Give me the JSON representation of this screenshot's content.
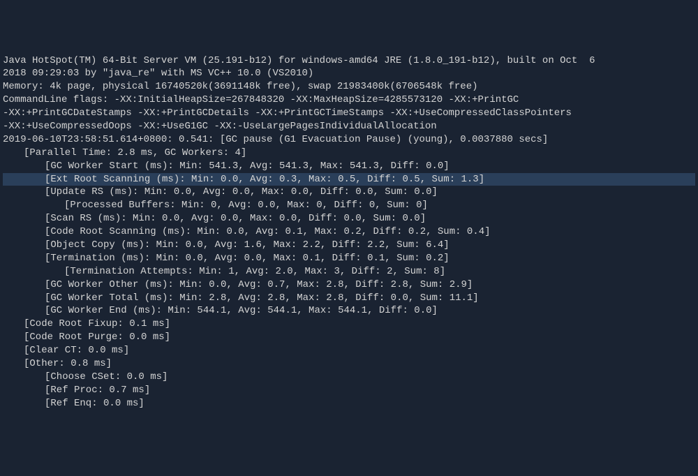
{
  "lines": [
    {
      "text": "Java HotSpot(TM) 64-Bit Server VM (25.191-b12) for windows-amd64 JRE (1.8.0_191-b12), built on Oct  6",
      "indent": 0
    },
    {
      "text": "2018 09:29:03 by \"java_re\" with MS VC++ 10.0 (VS2010)",
      "indent": 0
    },
    {
      "text": "Memory: 4k page, physical 16740520k(3691148k free), swap 21983400k(6706548k free)",
      "indent": 0
    },
    {
      "text": "CommandLine flags: -XX:InitialHeapSize=267848320 -XX:MaxHeapSize=4285573120 -XX:+PrintGC",
      "indent": 0
    },
    {
      "text": "-XX:+PrintGCDateStamps -XX:+PrintGCDetails -XX:+PrintGCTimeStamps -XX:+UseCompressedClassPointers",
      "indent": 0
    },
    {
      "text": "-XX:+UseCompressedOops -XX:+UseG1GC -XX:-UseLargePagesIndividualAllocation",
      "indent": 0
    },
    {
      "text": "2019-06-10T23:58:51.614+0800: 0.541: [GC pause (G1 Evacuation Pause) (young), 0.0037880 secs]",
      "indent": 0
    },
    {
      "text": "[Parallel Time: 2.8 ms, GC Workers: 4]",
      "indent": 1
    },
    {
      "text": "[GC Worker Start (ms): Min: 541.3, Avg: 541.3, Max: 541.3, Diff: 0.0]",
      "indent": 2
    },
    {
      "text": "[Ext Root Scanning (ms): Min: 0.0, Avg: 0.3, Max: 0.5, Diff: 0.5, Sum: 1.3]",
      "indent": 2,
      "highlighted": true
    },
    {
      "text": "[Update RS (ms): Min: 0.0, Avg: 0.0, Max: 0.0, Diff: 0.0, Sum: 0.0]",
      "indent": 2
    },
    {
      "text": "[Processed Buffers: Min: 0, Avg: 0.0, Max: 0, Diff: 0, Sum: 0]",
      "indent": 3
    },
    {
      "text": "[Scan RS (ms): Min: 0.0, Avg: 0.0, Max: 0.0, Diff: 0.0, Sum: 0.0]",
      "indent": 2
    },
    {
      "text": "[Code Root Scanning (ms): Min: 0.0, Avg: 0.1, Max: 0.2, Diff: 0.2, Sum: 0.4]",
      "indent": 2
    },
    {
      "text": "[Object Copy (ms): Min: 0.0, Avg: 1.6, Max: 2.2, Diff: 2.2, Sum: 6.4]",
      "indent": 2
    },
    {
      "text": "[Termination (ms): Min: 0.0, Avg: 0.0, Max: 0.1, Diff: 0.1, Sum: 0.2]",
      "indent": 2
    },
    {
      "text": "[Termination Attempts: Min: 1, Avg: 2.0, Max: 3, Diff: 2, Sum: 8]",
      "indent": 3
    },
    {
      "text": "[GC Worker Other (ms): Min: 0.0, Avg: 0.7, Max: 2.8, Diff: 2.8, Sum: 2.9]",
      "indent": 2
    },
    {
      "text": "[GC Worker Total (ms): Min: 2.8, Avg: 2.8, Max: 2.8, Diff: 0.0, Sum: 11.1]",
      "indent": 2
    },
    {
      "text": "[GC Worker End (ms): Min: 544.1, Avg: 544.1, Max: 544.1, Diff: 0.0]",
      "indent": 2
    },
    {
      "text": "[Code Root Fixup: 0.1 ms]",
      "indent": 1
    },
    {
      "text": "[Code Root Purge: 0.0 ms]",
      "indent": 1
    },
    {
      "text": "[Clear CT: 0.0 ms]",
      "indent": 1
    },
    {
      "text": "[Other: 0.8 ms]",
      "indent": 1
    },
    {
      "text": "[Choose CSet: 0.0 ms]",
      "indent": 2
    },
    {
      "text": "[Ref Proc: 0.7 ms]",
      "indent": 2
    },
    {
      "text": "[Ref Enq: 0.0 ms]",
      "indent": 2
    }
  ]
}
